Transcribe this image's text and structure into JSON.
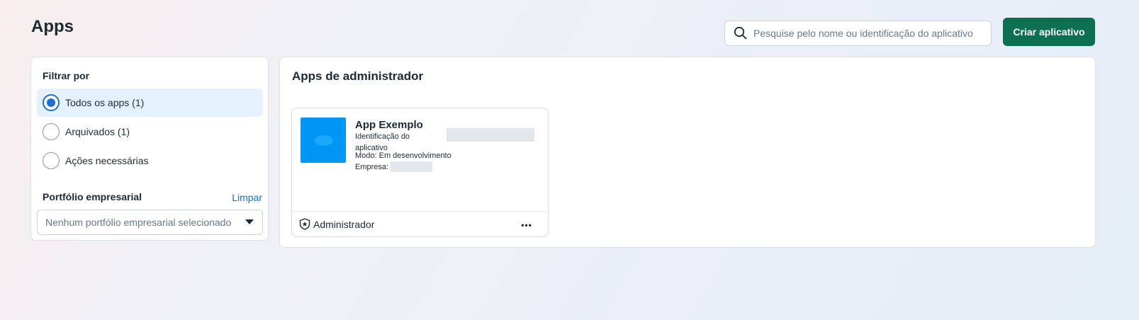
{
  "page": {
    "title": "Apps"
  },
  "search": {
    "placeholder": "Pesquise pelo nome ou identificação do aplicativo",
    "icon": "search-icon"
  },
  "actions": {
    "create_label": "Criar aplicativo",
    "accent_color": "#0a7050"
  },
  "filter": {
    "title": "Filtrar por",
    "options": [
      {
        "label": "Todos os apps (1)",
        "selected": true
      },
      {
        "label": "Arquivados (1)",
        "selected": false
      },
      {
        "label": "Ações necessárias",
        "selected": false
      }
    ],
    "portfolio_title": "Portfólio empresarial",
    "clear_label": "Limpar",
    "portfolio_select_placeholder": "Nenhum portfólio empresarial selecionado"
  },
  "main": {
    "title": "Apps de administrador",
    "apps": [
      {
        "name": "App Exemplo",
        "id_label": "Identificação do aplicativo",
        "mode": "Modo: Em desenvolvimento",
        "company_label": "Empresa:",
        "role": "Administrador",
        "role_icon": "shield-star-icon",
        "more_label": "•••",
        "icon_color": "#0096f6"
      }
    ]
  }
}
